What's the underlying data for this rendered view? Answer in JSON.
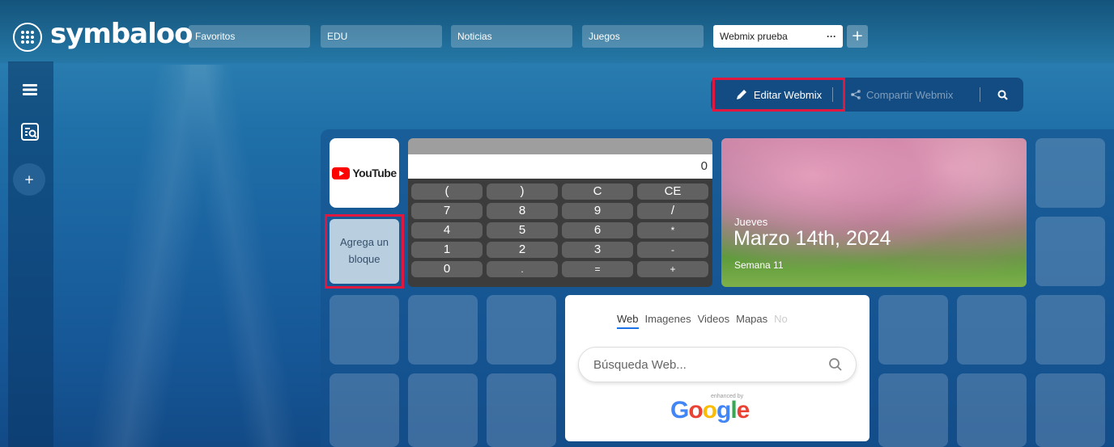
{
  "app": {
    "logo_text": "symbaloo"
  },
  "tabs": [
    {
      "label": "Favoritos"
    },
    {
      "label": "EDU"
    },
    {
      "label": "Noticias"
    },
    {
      "label": "Juegos"
    },
    {
      "label": "Webmix prueba",
      "menu": "···",
      "active": true
    }
  ],
  "tab_add_label": "+",
  "left_rail": {
    "add_label": "+"
  },
  "actions": {
    "edit_label": "Editar Webmix",
    "share_label": "Compartir Webmix"
  },
  "tiles": {
    "youtube_label": "YouTube",
    "add_block_label": "Agrega un bloque"
  },
  "calculator": {
    "display": "0",
    "keys": [
      "(",
      ")",
      "C",
      "CE",
      "7",
      "8",
      "9",
      "/",
      "4",
      "5",
      "6",
      "*",
      "1",
      "2",
      "3",
      "-",
      "0",
      ".",
      "=",
      "+"
    ]
  },
  "date_widget": {
    "day": "Jueves",
    "date": "Marzo 14th, 2024",
    "week": "Semana 11"
  },
  "google_widget": {
    "tabs": [
      "Web",
      "Imagenes",
      "Videos",
      "Mapas",
      "No"
    ],
    "search_placeholder": "Búsqueda Web...",
    "enhanced_by": "enhanced by",
    "logo_text": "Google"
  },
  "colors": {
    "highlight": "#e0173f",
    "action_bar": "#134c82",
    "youtube_red": "#ff0000"
  }
}
